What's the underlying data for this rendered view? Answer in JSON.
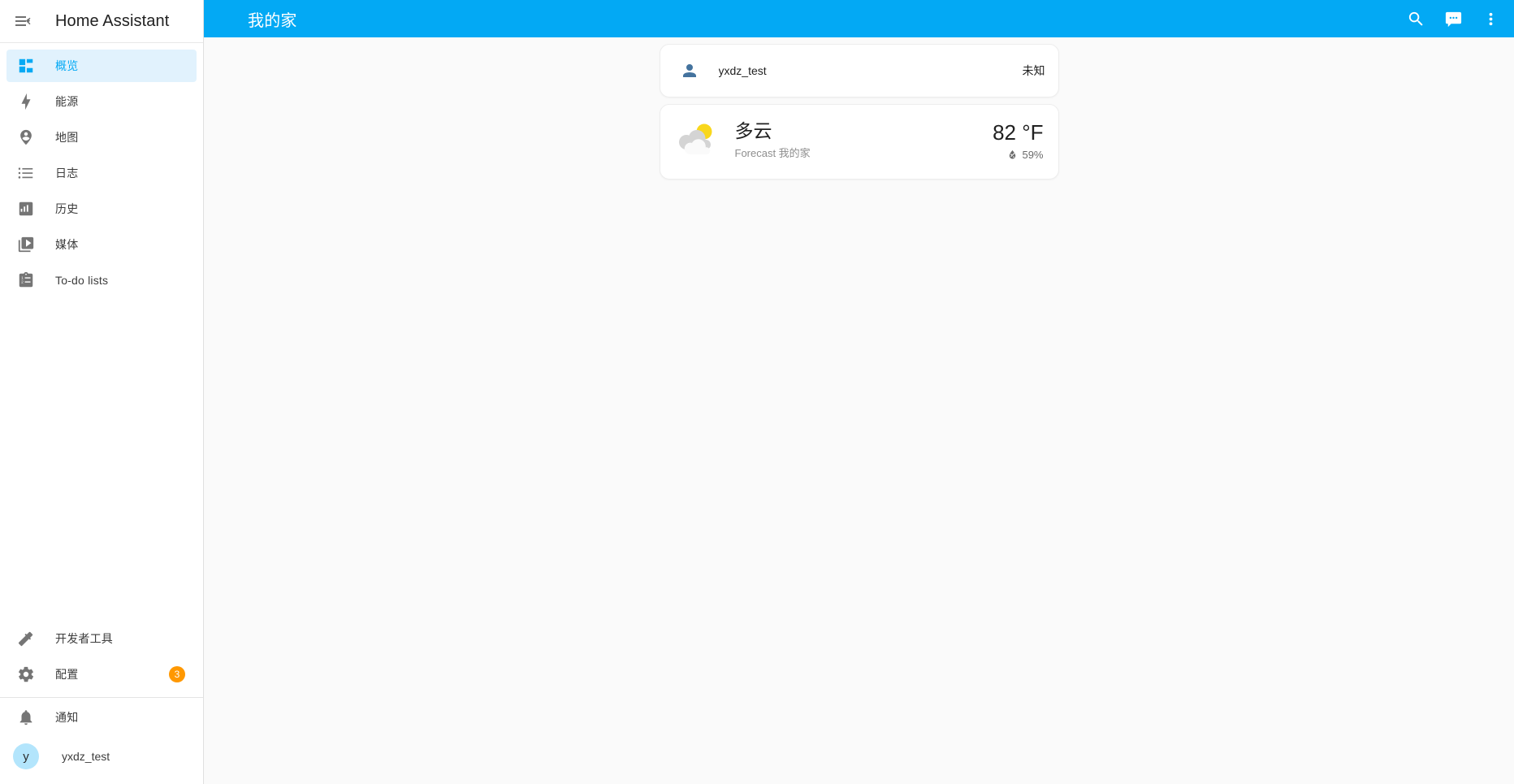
{
  "sidebar": {
    "menu_icon": "menu-open-icon",
    "title": "Home Assistant",
    "items": [
      {
        "label": "概览",
        "icon": "view-dashboard-icon",
        "active": true,
        "badge": ""
      },
      {
        "label": "能源",
        "icon": "lightning-bolt-icon",
        "active": false,
        "badge": ""
      },
      {
        "label": "地图",
        "icon": "map-marker-account-icon",
        "active": false,
        "badge": ""
      },
      {
        "label": "日志",
        "icon": "format-list-bulleted-icon",
        "active": false,
        "badge": ""
      },
      {
        "label": "历史",
        "icon": "chart-box-icon",
        "active": false,
        "badge": ""
      },
      {
        "label": "媒体",
        "icon": "play-box-multiple-icon",
        "active": false,
        "badge": ""
      },
      {
        "label": "To-do lists",
        "icon": "clipboard-list-icon",
        "active": false,
        "badge": ""
      }
    ],
    "bottom_items": [
      {
        "label": "开发者工具",
        "icon": "hammer-icon",
        "badge": ""
      },
      {
        "label": "配置",
        "icon": "cog-icon",
        "badge": "3"
      }
    ],
    "notifications": {
      "label": "通知",
      "icon": "bell-icon"
    },
    "profile": {
      "label": "yxdz_test",
      "avatar_initial": "y"
    },
    "badge_color": "#ff9800",
    "active_color": "#03a9f4"
  },
  "header": {
    "title": "我的家",
    "accent_color": "#03a9f4",
    "actions": [
      {
        "name": "search-icon",
        "label": "搜索"
      },
      {
        "name": "assist-icon",
        "label": "Assist"
      },
      {
        "name": "overflow-menu-icon",
        "label": "更多选项"
      }
    ]
  },
  "main": {
    "person_card": {
      "icon": "account-icon",
      "name": "yxdz_test",
      "state": "未知"
    },
    "weather_card": {
      "icon": "partly-cloudy-icon",
      "condition": "多云",
      "subtitle": "Forecast 我的家",
      "temperature": "82 °F",
      "humidity": "59%",
      "humidity_icon": "water-percent-icon"
    }
  }
}
